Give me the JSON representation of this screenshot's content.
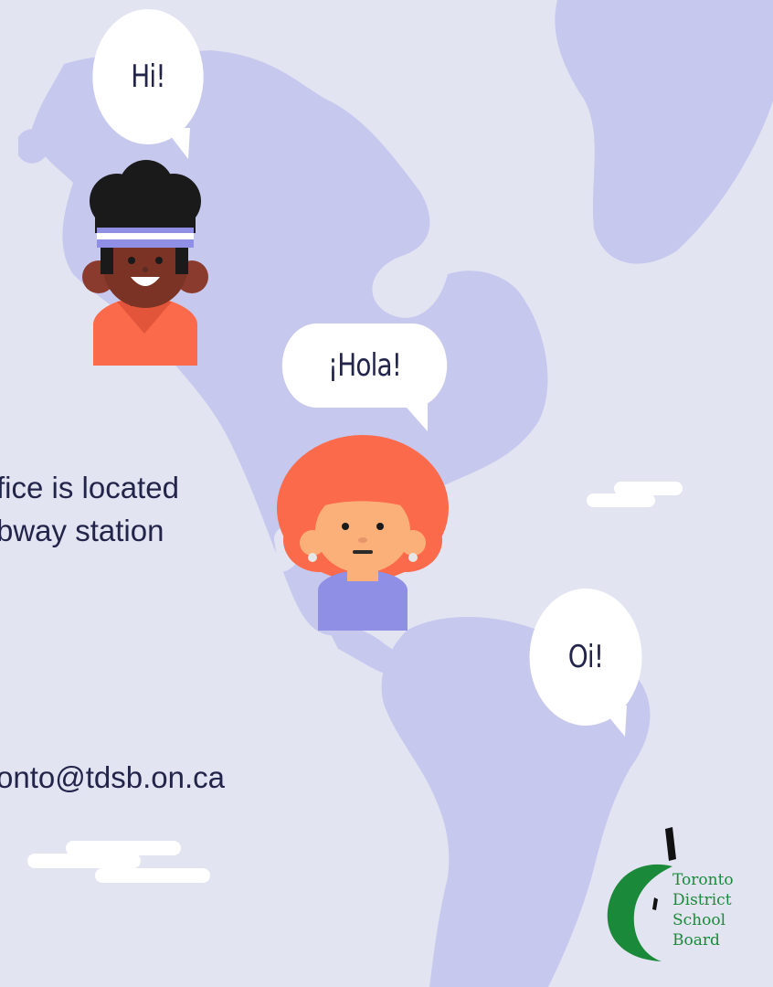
{
  "greetings": {
    "hi": "Hi!",
    "hola": "¡Hola!",
    "oi": "Oi!"
  },
  "contact": {
    "location_line1": "fice is located",
    "location_line2": "bway station",
    "email": "onto@tdsb.on.ca"
  },
  "logo": {
    "line1": "Toronto",
    "line2": "District",
    "line3": "School",
    "line4": "Board"
  },
  "colors": {
    "background": "#e3e4f2",
    "continent": "#c7c8ee",
    "text": "#23244a",
    "accent_orange": "#fb6a4a",
    "brand_green": "#1a8a3a"
  }
}
